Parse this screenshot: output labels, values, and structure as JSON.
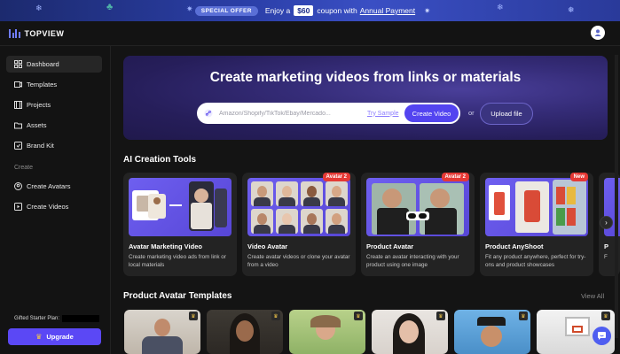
{
  "banner": {
    "badge": "SPECIAL OFFER",
    "text_before": "Enjoy a",
    "coupon": "$60",
    "text_after": "coupon with",
    "link": "Annual Payment"
  },
  "app": {
    "name": "TOPVIEW"
  },
  "sidebar": {
    "items": [
      {
        "label": "Dashboard",
        "icon": "grid-icon"
      },
      {
        "label": "Templates",
        "icon": "video-icon"
      },
      {
        "label": "Projects",
        "icon": "film-icon"
      },
      {
        "label": "Assets",
        "icon": "folder-icon"
      },
      {
        "label": "Brand Kit",
        "icon": "brand-icon"
      }
    ],
    "section": "Create",
    "create_items": [
      {
        "label": "Create Avatars",
        "icon": "avatar-icon"
      },
      {
        "label": "Create Videos",
        "icon": "play-icon"
      }
    ],
    "plan_label": "Gifted Starter Plan:",
    "upgrade_label": "Upgrade"
  },
  "hero": {
    "title": "Create marketing videos from links or materials",
    "placeholder": "Amazon/Shopify/TikTok/Ebay/Mercado...",
    "try_sample": "Try Sample",
    "create_button": "Create Video",
    "or": "or",
    "upload_button": "Upload file"
  },
  "tools": {
    "title": "AI Creation Tools",
    "cards": [
      {
        "name": "Avatar Marketing Video",
        "desc": "Create marketing video ads from link or local materials",
        "tag": ""
      },
      {
        "name": "Video Avatar",
        "desc": "Create avatar videos or clone your avatar from a video",
        "tag": "Avatar 2"
      },
      {
        "name": "Product Avatar",
        "desc": "Create an avatar interacting with your product using one image",
        "tag": "Avatar 2"
      },
      {
        "name": "Product AnyShoot",
        "desc": "Fit any product anywhere, perfect for try-ons and product showcases",
        "tag": "New"
      },
      {
        "name": "P",
        "desc": "F",
        "tag": ""
      }
    ]
  },
  "templates": {
    "title": "Product Avatar Templates",
    "view_all": "View All"
  },
  "colors": {
    "accent": "#5b48f5",
    "hero_bg": "#2a2266",
    "tag_red": "#e53935"
  }
}
